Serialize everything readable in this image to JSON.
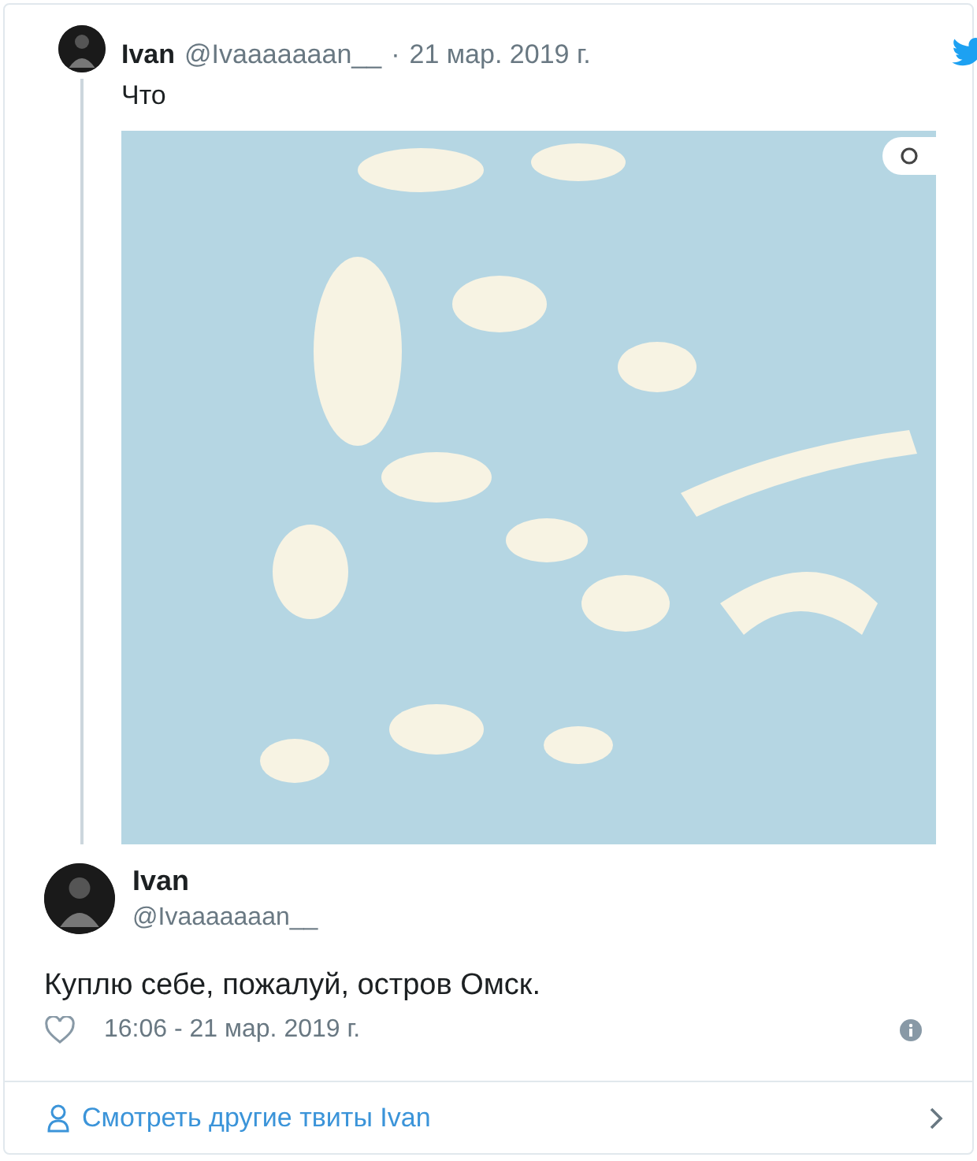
{
  "quoted_tweet": {
    "name": "Ivan",
    "handle": "@Ivaaaaaaan__",
    "separator": "·",
    "date": "21 мар. 2019 г.",
    "text": "Что"
  },
  "tweet": {
    "name": "Ivan",
    "handle": "@Ivaaaaaaan__",
    "text": "Куплю себе, пожалуй, остров Омск.",
    "time": "16:06 - 21 мар. 2019 г."
  },
  "footer": {
    "link": "Смотреть другие твиты Ivan"
  }
}
